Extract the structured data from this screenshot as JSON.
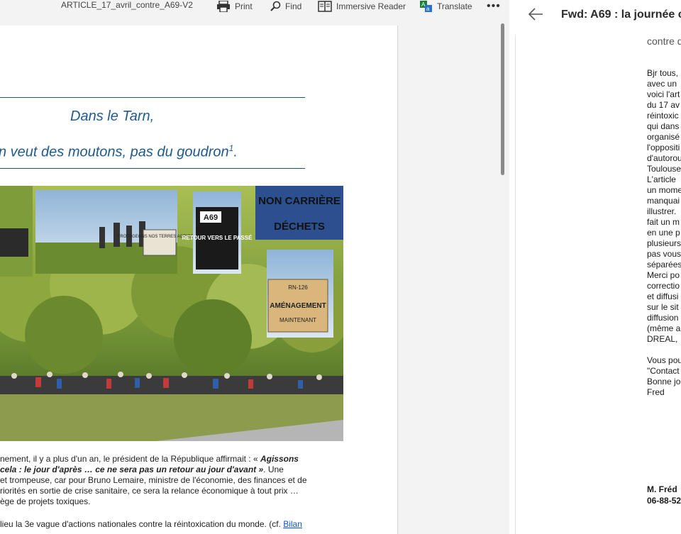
{
  "toolbar": {
    "filename": "ARTICLE_17_avril_contre_A69-V2",
    "print_label": "Print",
    "find_label": "Find",
    "immersive_label": "Immersive Reader",
    "translate_label": "Translate",
    "more_label": "•••"
  },
  "document": {
    "heading1": "Dans le Tarn,",
    "heading2": "n veut des moutons, pas du goudron",
    "footnote_ref": "1",
    "heading2_end": ".",
    "photo_signs": {
      "protegeons": "PROTÉGEONS NOS TERRES AGRICOLES",
      "a69": "A69",
      "retour": "RETOUR VERS LE PASSÉ",
      "non_carriere": "NON CARRIÈRE",
      "dechets": "DÉCHETS",
      "rn126": "RN-126",
      "amenagement": "AMÉNAGEMENT",
      "maintenant": "MAINTENANT"
    },
    "body_lines": [
      "nement, il y a plus d'un an, le président de la République affirmait : «",
      "Agissons",
      "cela : le jour d'après … ce ne sera pas un retour au jour d'avant »",
      ". Une",
      "et trompeuse, car pour Bruno Lemaire,  ministre de l'économie, des finances et de",
      "riorités en sortie de crise sanitaire, ce sera la relance économique à tout prix …",
      "ège de projets toxiques."
    ],
    "para2_text": "lieu la 3e vague d'actions nationales contre la réintoxication du monde. (cf.",
    "para2_link": "Bilan"
  },
  "email": {
    "subject": "Fwd: A69 : la journée c",
    "preview": "contre d",
    "body_lines": [
      "Bjr tous,",
      "avec un",
      "voici l'art",
      "du 17 av",
      "réintoxic",
      "qui dans",
      "organisé",
      "l'oppositi",
      "d'autorou",
      "Toulouse",
      "L'article",
      "un mome",
      "manquai",
      "illustrer.",
      "fait un m",
      "en une p",
      "plusieurs",
      "pas vous",
      "séparées",
      "Merci po",
      "correctio",
      "et diffusi",
      "sur le sit",
      "diffusion",
      "(même a",
      "DREAL,"
    ],
    "closing_lines": [
      "Vous pou",
      "\"Contact",
      "Bonne jo",
      "Fred"
    ],
    "sig_name": "M. Fréd",
    "sig_phone": "06-88-52"
  },
  "colors": {
    "heading": "#1f5b8f",
    "rule": "#1f4e79",
    "link": "#1155cc",
    "toolbar_bg": "#f3f3f3"
  }
}
